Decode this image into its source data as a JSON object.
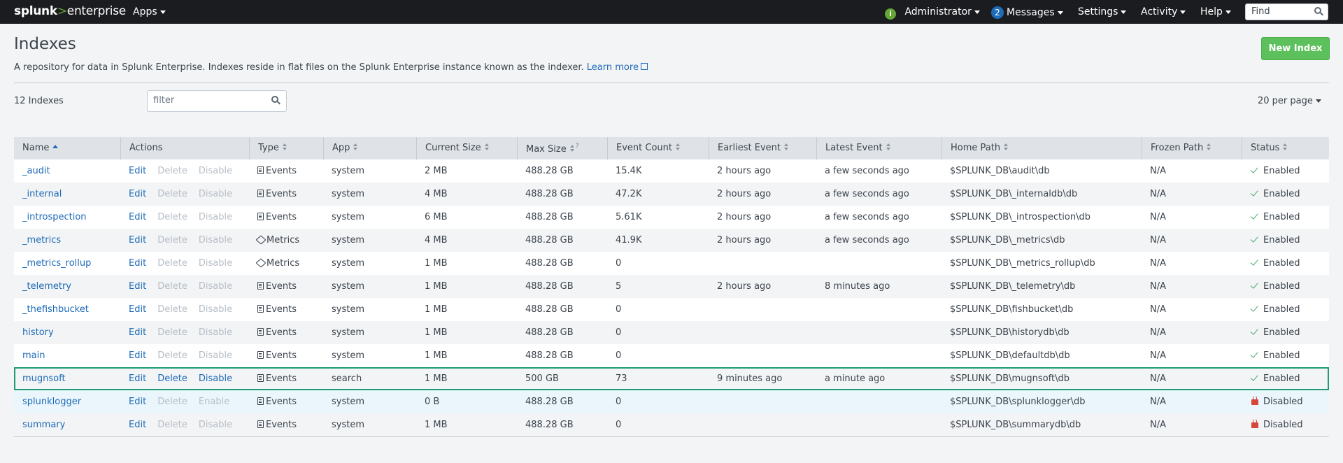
{
  "topbar": {
    "logo_a": "splunk",
    "logo_b": ">",
    "logo_c": "enterprise",
    "apps": "Apps",
    "admin": "Administrator",
    "messages_count": "2",
    "messages": "Messages",
    "settings": "Settings",
    "activity": "Activity",
    "help": "Help",
    "find_placeholder": "Find"
  },
  "page": {
    "title": "Indexes",
    "description": "A repository for data in Splunk Enterprise. Indexes reside in flat files on the Splunk Enterprise instance known as the indexer.",
    "learn_more": "Learn more",
    "new_index": "New Index",
    "count_label": "12 Indexes",
    "filter_placeholder": "filter",
    "per_page": "20 per page"
  },
  "table": {
    "columns": {
      "name": "Name",
      "actions": "Actions",
      "type": "Type",
      "app": "App",
      "current_size": "Current Size",
      "max_size": "Max Size",
      "event_count": "Event Count",
      "earliest": "Earliest Event",
      "latest": "Latest Event",
      "home_path": "Home Path",
      "frozen_path": "Frozen Path",
      "status": "Status"
    },
    "rows": [
      {
        "name": "_audit",
        "edit": "Edit",
        "delete": "Delete",
        "toggle": "Disable",
        "type": "Events",
        "app": "system",
        "size": "2 MB",
        "max": "488.28 GB",
        "count": "15.4K",
        "earliest": "2 hours ago",
        "latest": "a few seconds ago",
        "home": "$SPLUNK_DB\\audit\\db",
        "frozen": "N/A",
        "status": "Enabled"
      },
      {
        "name": "_internal",
        "edit": "Edit",
        "delete": "Delete",
        "toggle": "Disable",
        "type": "Events",
        "app": "system",
        "size": "4 MB",
        "max": "488.28 GB",
        "count": "47.2K",
        "earliest": "2 hours ago",
        "latest": "a few seconds ago",
        "home": "$SPLUNK_DB\\_internaldb\\db",
        "frozen": "N/A",
        "status": "Enabled"
      },
      {
        "name": "_introspection",
        "edit": "Edit",
        "delete": "Delete",
        "toggle": "Disable",
        "type": "Events",
        "app": "system",
        "size": "6 MB",
        "max": "488.28 GB",
        "count": "5.61K",
        "earliest": "2 hours ago",
        "latest": "a few seconds ago",
        "home": "$SPLUNK_DB\\_introspection\\db",
        "frozen": "N/A",
        "status": "Enabled"
      },
      {
        "name": "_metrics",
        "edit": "Edit",
        "delete": "Delete",
        "toggle": "Disable",
        "type": "Metrics",
        "app": "system",
        "size": "4 MB",
        "max": "488.28 GB",
        "count": "41.9K",
        "earliest": "2 hours ago",
        "latest": "a few seconds ago",
        "home": "$SPLUNK_DB\\_metrics\\db",
        "frozen": "N/A",
        "status": "Enabled"
      },
      {
        "name": "_metrics_rollup",
        "edit": "Edit",
        "delete": "Delete",
        "toggle": "Disable",
        "type": "Metrics",
        "app": "system",
        "size": "1 MB",
        "max": "488.28 GB",
        "count": "0",
        "earliest": "",
        "latest": "",
        "home": "$SPLUNK_DB\\_metrics_rollup\\db",
        "frozen": "N/A",
        "status": "Enabled"
      },
      {
        "name": "_telemetry",
        "edit": "Edit",
        "delete": "Delete",
        "toggle": "Disable",
        "type": "Events",
        "app": "system",
        "size": "1 MB",
        "max": "488.28 GB",
        "count": "5",
        "earliest": "2 hours ago",
        "latest": "8 minutes ago",
        "home": "$SPLUNK_DB\\_telemetry\\db",
        "frozen": "N/A",
        "status": "Enabled"
      },
      {
        "name": "_thefishbucket",
        "edit": "Edit",
        "delete": "Delete",
        "toggle": "Disable",
        "type": "Events",
        "app": "system",
        "size": "1 MB",
        "max": "488.28 GB",
        "count": "0",
        "earliest": "",
        "latest": "",
        "home": "$SPLUNK_DB\\fishbucket\\db",
        "frozen": "N/A",
        "status": "Enabled"
      },
      {
        "name": "history",
        "edit": "Edit",
        "delete": "Delete",
        "toggle": "Disable",
        "type": "Events",
        "app": "system",
        "size": "1 MB",
        "max": "488.28 GB",
        "count": "0",
        "earliest": "",
        "latest": "",
        "home": "$SPLUNK_DB\\historydb\\db",
        "frozen": "N/A",
        "status": "Enabled"
      },
      {
        "name": "main",
        "edit": "Edit",
        "delete": "Delete",
        "toggle": "Disable",
        "type": "Events",
        "app": "system",
        "size": "1 MB",
        "max": "488.28 GB",
        "count": "0",
        "earliest": "",
        "latest": "",
        "home": "$SPLUNK_DB\\defaultdb\\db",
        "frozen": "N/A",
        "status": "Enabled"
      },
      {
        "name": "mugnsoft",
        "edit": "Edit",
        "delete": "Delete",
        "toggle": "Disable",
        "type": "Events",
        "app": "search",
        "size": "1 MB",
        "max": "500 GB",
        "count": "73",
        "earliest": "9 minutes ago",
        "latest": "a minute ago",
        "home": "$SPLUNK_DB\\mugnsoft\\db",
        "frozen": "N/A",
        "status": "Enabled"
      },
      {
        "name": "splunklogger",
        "edit": "Edit",
        "delete": "Delete",
        "toggle": "Enable",
        "type": "Events",
        "app": "system",
        "size": "0 B",
        "max": "488.28 GB",
        "count": "0",
        "earliest": "",
        "latest": "",
        "home": "$SPLUNK_DB\\splunklogger\\db",
        "frozen": "N/A",
        "status": "Disabled"
      },
      {
        "name": "summary",
        "edit": "Edit",
        "delete": "Delete",
        "toggle": "Disable",
        "type": "Events",
        "app": "system",
        "size": "1 MB",
        "max": "488.28 GB",
        "count": "0",
        "earliest": "",
        "latest": "",
        "home": "$SPLUNK_DB\\summarydb\\db",
        "frozen": "N/A",
        "status": "Disabled"
      }
    ]
  }
}
